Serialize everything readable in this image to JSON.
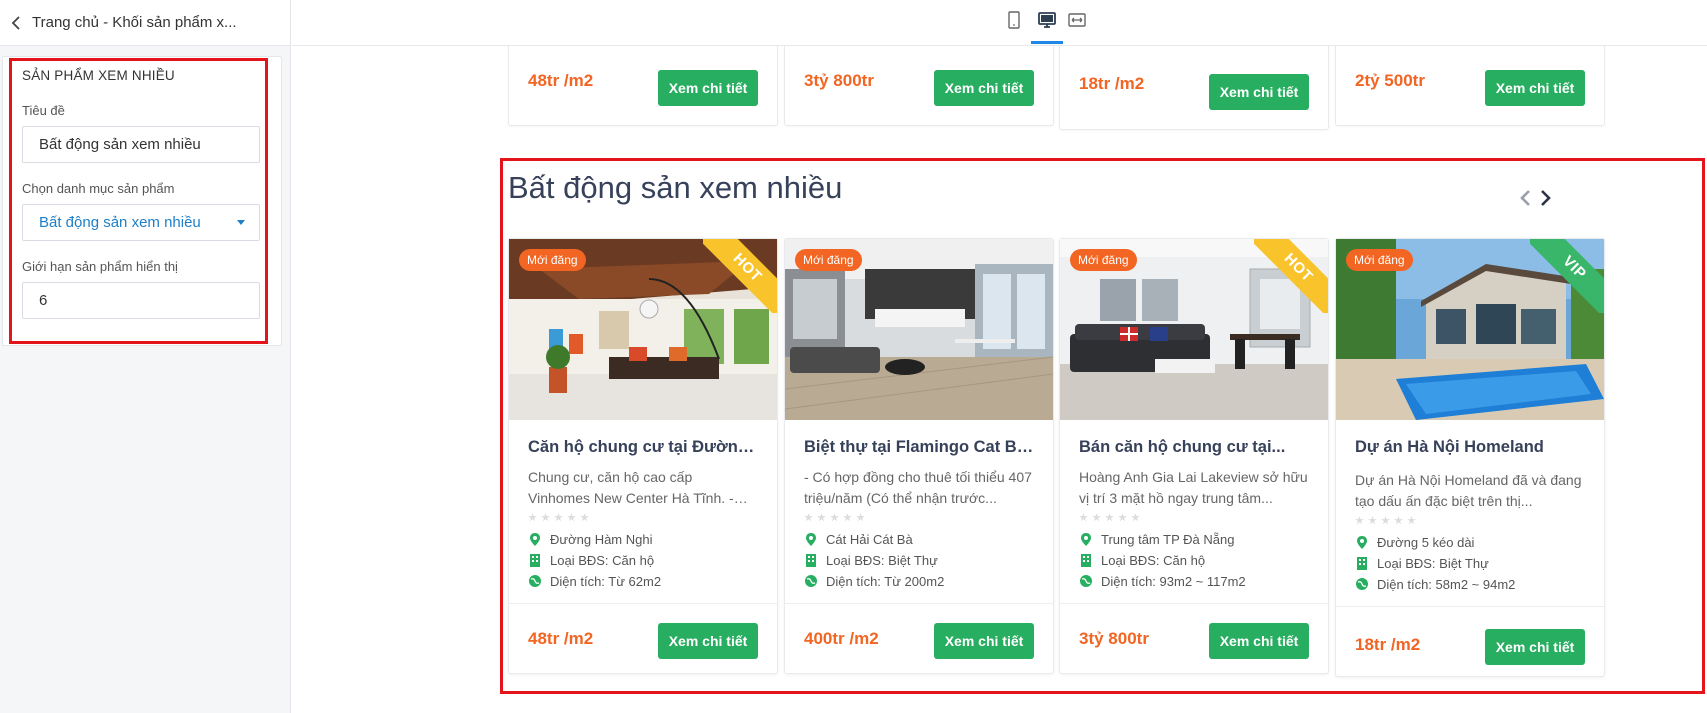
{
  "header": {
    "title": "Trang chủ - Khối sản phẩm x..."
  },
  "panel": {
    "section_title": "SẢN PHẨM XEM NHIỀU",
    "title_label": "Tiêu đề",
    "title_value": "Bất động sản xem nhiều",
    "category_label": "Chọn danh mục sản phẩm",
    "category_value": "Bất động sản xem nhiều",
    "limit_label": "Giới hạn sản phẩm hiển thị",
    "limit_value": "6"
  },
  "devices": [
    "mobile-icon",
    "desktop-icon",
    "fullwidth-icon"
  ],
  "colors": {
    "accent": "#1e88e5",
    "price": "#f26522",
    "button": "#27ae60",
    "outline": "#e4141b",
    "hot": "#f9c32b",
    "vip": "#3ab66a"
  },
  "prev_row": [
    {
      "price": "48tr /m2",
      "button": "Xem chi tiết"
    },
    {
      "price": "3tỷ 800tr",
      "button": "Xem chi tiết"
    },
    {
      "price": "18tr /m2",
      "button": "Xem chi tiết"
    },
    {
      "price": "2tỷ 500tr",
      "button": "Xem chi tiết"
    }
  ],
  "section": {
    "title": "Bất động sản xem nhiều",
    "cards": [
      {
        "badge": "Mới đăng",
        "ribbon": "HOT",
        "title": "Căn hộ chung cư tại Đường...",
        "desc": "Chung cư, căn hộ cao cấp Vinhomes New Center Hà Tĩnh. - Mặt...",
        "location": "Đường Hàm Nghi",
        "type": "Loại BĐS: Căn hộ",
        "area": "Diện tích: Từ 62m2",
        "price": "48tr /m2",
        "button": "Xem chi tiết"
      },
      {
        "badge": "Mới đăng",
        "ribbon": "",
        "title": "Biệt thự tại Flamingo Cat Ba...",
        "desc": "- Có hợp đồng cho thuê tối thiểu 407 triệu/năm (Có thể nhận trước...",
        "location": "Cát Hải Cát Bà",
        "type": "Loại BĐS: Biệt Thự",
        "area": "Diện tích: Từ 200m2",
        "price": "400tr /m2",
        "button": "Xem chi tiết"
      },
      {
        "badge": "Mới đăng",
        "ribbon": "HOT",
        "title": "Bán căn hộ chung cư tại...",
        "desc": "Hoàng Anh Gia Lai Lakeview sở hữu vị trí 3 mặt hồ ngay trung tâm...",
        "location": "Trung tâm TP Đà Nẵng",
        "type": "Loại BĐS: Căn hộ",
        "area": "Diện tích: 93m2 ~ 117m2",
        "price": "3tỷ 800tr",
        "button": "Xem chi tiết"
      },
      {
        "badge": "Mới đăng",
        "ribbon": "VIP",
        "title": "Dự án Hà Nội Homeland",
        "desc": "Dự án Hà Nội Homeland đã và đang tạo dấu ấn đặc biệt trên thị...",
        "location": "Đường 5 kéo dài",
        "type": "Loại BĐS: Biệt Thự",
        "area": "Diện tích: 58m2 ~ 94m2",
        "price": "18tr /m2",
        "button": "Xem chi tiết"
      }
    ]
  }
}
